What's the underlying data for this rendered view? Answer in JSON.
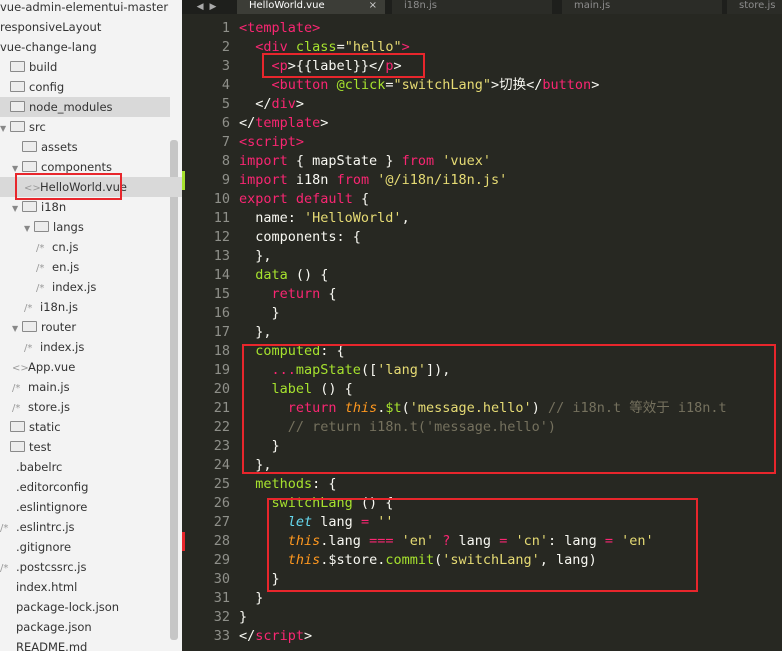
{
  "sidebar": {
    "items": [
      {
        "label": "vue-admin-elementui-master",
        "kind": "text",
        "indent": 0
      },
      {
        "label": "responsiveLayout",
        "kind": "text",
        "indent": 0
      },
      {
        "label": "vue-change-lang",
        "kind": "text",
        "indent": 0
      },
      {
        "label": "build",
        "kind": "folder",
        "indent": 1
      },
      {
        "label": "config",
        "kind": "folder",
        "indent": 1
      },
      {
        "label": "node_modules",
        "kind": "folder",
        "indent": 1,
        "highlight": true
      },
      {
        "label": "src",
        "kind": "open-folder",
        "indent": 1
      },
      {
        "label": "assets",
        "kind": "folder",
        "indent": 2
      },
      {
        "label": "components",
        "kind": "open-folder",
        "indent": 2
      },
      {
        "label": "HelloWorld.vue",
        "kind": "vue",
        "indent": 3,
        "highlight": true
      },
      {
        "label": "i18n",
        "kind": "open-folder",
        "indent": 2
      },
      {
        "label": "langs",
        "kind": "open-folder",
        "indent": 3
      },
      {
        "label": "cn.js",
        "kind": "js",
        "indent": 4
      },
      {
        "label": "en.js",
        "kind": "js",
        "indent": 4
      },
      {
        "label": "index.js",
        "kind": "js",
        "indent": 4
      },
      {
        "label": "i18n.js",
        "kind": "js",
        "indent": 3
      },
      {
        "label": "router",
        "kind": "open-folder",
        "indent": 2
      },
      {
        "label": "index.js",
        "kind": "js",
        "indent": 3
      },
      {
        "label": "App.vue",
        "kind": "vue",
        "indent": 2
      },
      {
        "label": "main.js",
        "kind": "js",
        "indent": 2
      },
      {
        "label": "store.js",
        "kind": "js",
        "indent": 2
      },
      {
        "label": "static",
        "kind": "folder",
        "indent": 1
      },
      {
        "label": "test",
        "kind": "folder",
        "indent": 1
      },
      {
        "label": ".babelrc",
        "kind": "file",
        "indent": 1
      },
      {
        "label": ".editorconfig",
        "kind": "file",
        "indent": 1
      },
      {
        "label": ".eslintignore",
        "kind": "file",
        "indent": 1
      },
      {
        "label": ".eslintrc.js",
        "kind": "js",
        "indent": 1
      },
      {
        "label": ".gitignore",
        "kind": "file",
        "indent": 1
      },
      {
        "label": ".postcssrc.js",
        "kind": "js",
        "indent": 1
      },
      {
        "label": "index.html",
        "kind": "file",
        "indent": 1
      },
      {
        "label": "package-lock.json",
        "kind": "file",
        "indent": 1
      },
      {
        "label": "package.json",
        "kind": "file",
        "indent": 1
      },
      {
        "label": "README.md",
        "kind": "file",
        "indent": 1
      }
    ]
  },
  "tabs": [
    {
      "label": "HelloWorld.vue",
      "active": true,
      "close": "×"
    },
    {
      "label": "i18n.js",
      "active": false
    },
    {
      "label": "main.js",
      "active": false
    },
    {
      "label": "store.js",
      "active": false
    }
  ],
  "tab_nav": "◀▶",
  "colors": {
    "editor_bg": "#272822",
    "tag": "#f92672",
    "attr": "#a6e22e",
    "string": "#e6db74",
    "comment": "#75715e",
    "this": "#fd971f",
    "highlight_box": "#e8262c"
  },
  "code": [
    {
      "n": "1",
      "t": [
        [
          "tag",
          "<template>"
        ]
      ]
    },
    {
      "n": "2",
      "t": [
        [
          "pl",
          "  "
        ],
        [
          "tag",
          "<div"
        ],
        [
          "pl",
          " "
        ],
        [
          "attr",
          "class"
        ],
        [
          "pl",
          "="
        ],
        [
          "str",
          "\"hello\""
        ],
        [
          "tag",
          ">"
        ]
      ]
    },
    {
      "n": "3",
      "t": [
        [
          "pl",
          "    "
        ],
        [
          "tag",
          "<p"
        ],
        [
          "pl",
          ">{{label}}</"
        ],
        [
          "tag",
          "p"
        ],
        [
          "pl",
          ">"
        ]
      ]
    },
    {
      "n": "4",
      "t": [
        [
          "pl",
          "    "
        ],
        [
          "tag",
          "<button"
        ],
        [
          "pl",
          " "
        ],
        [
          "attr",
          "@click"
        ],
        [
          "pl",
          "="
        ],
        [
          "str",
          "\"switchLang\""
        ],
        [
          "pl",
          ">切换</"
        ],
        [
          "tag",
          "button"
        ],
        [
          "pl",
          ">"
        ]
      ]
    },
    {
      "n": "5",
      "t": [
        [
          "pl",
          "  </"
        ],
        [
          "tag",
          "div"
        ],
        [
          "pl",
          ">"
        ]
      ]
    },
    {
      "n": "6",
      "t": [
        [
          "pl",
          "</"
        ],
        [
          "tag",
          "template"
        ],
        [
          "pl",
          ">"
        ]
      ]
    },
    {
      "n": "7",
      "t": [
        [
          "tag",
          "<script>"
        ]
      ]
    },
    {
      "n": "8",
      "t": [
        [
          "kw",
          "import"
        ],
        [
          "pl",
          " { mapState } "
        ],
        [
          "kw",
          "from"
        ],
        [
          "pl",
          " "
        ],
        [
          "str",
          "'vuex'"
        ]
      ]
    },
    {
      "n": "9",
      "t": [
        [
          "kw",
          "import"
        ],
        [
          "pl",
          " i18n "
        ],
        [
          "kw",
          "from"
        ],
        [
          "pl",
          " "
        ],
        [
          "str",
          "'@/i18n/i18n.js'"
        ]
      ]
    },
    {
      "n": "10",
      "t": [
        [
          "kw",
          "export"
        ],
        [
          "pl",
          " "
        ],
        [
          "kw",
          "default"
        ],
        [
          "pl",
          " {"
        ]
      ]
    },
    {
      "n": "11",
      "t": [
        [
          "pl",
          "  name: "
        ],
        [
          "str",
          "'HelloWorld'"
        ],
        [
          "pl",
          ","
        ]
      ]
    },
    {
      "n": "12",
      "t": [
        [
          "pl",
          "  components: {"
        ]
      ]
    },
    {
      "n": "13",
      "t": [
        [
          "pl",
          "  },"
        ]
      ]
    },
    {
      "n": "14",
      "t": [
        [
          "pl",
          "  "
        ],
        [
          "fn",
          "data"
        ],
        [
          "pl",
          " () {"
        ]
      ]
    },
    {
      "n": "15",
      "t": [
        [
          "pl",
          "    "
        ],
        [
          "kw",
          "return"
        ],
        [
          "pl",
          " {"
        ]
      ]
    },
    {
      "n": "16",
      "t": [
        [
          "pl",
          "    }"
        ]
      ]
    },
    {
      "n": "17",
      "t": [
        [
          "pl",
          "  },"
        ]
      ]
    },
    {
      "n": "18",
      "t": [
        [
          "pl",
          "  "
        ],
        [
          "prop",
          "computed"
        ],
        [
          "pl",
          ": {"
        ]
      ]
    },
    {
      "n": "19",
      "t": [
        [
          "pl",
          "    "
        ],
        [
          "kw",
          "..."
        ],
        [
          "fn",
          "mapState"
        ],
        [
          "pl",
          "(["
        ],
        [
          "str",
          "'lang'"
        ],
        [
          "pl",
          "]),"
        ]
      ]
    },
    {
      "n": "20",
      "t": [
        [
          "pl",
          "    "
        ],
        [
          "fn",
          "label"
        ],
        [
          "pl",
          " () {"
        ]
      ]
    },
    {
      "n": "21",
      "t": [
        [
          "pl",
          "      "
        ],
        [
          "kw",
          "return"
        ],
        [
          "pl",
          " "
        ],
        [
          "this",
          "this"
        ],
        [
          "pl",
          "."
        ],
        [
          "fn",
          "$t"
        ],
        [
          "pl",
          "("
        ],
        [
          "str",
          "'message.hello'"
        ],
        [
          "pl",
          ") "
        ],
        [
          "cm",
          "// i18n.t 等效于 i18n.t"
        ]
      ]
    },
    {
      "n": "22",
      "t": [
        [
          "pl",
          "      "
        ],
        [
          "cm",
          "// return i18n.t('message.hello')"
        ]
      ]
    },
    {
      "n": "23",
      "t": [
        [
          "pl",
          "    }"
        ]
      ]
    },
    {
      "n": "24",
      "t": [
        [
          "pl",
          "  },"
        ]
      ]
    },
    {
      "n": "25",
      "t": [
        [
          "pl",
          "  "
        ],
        [
          "prop",
          "methods"
        ],
        [
          "pl",
          ": {"
        ]
      ]
    },
    {
      "n": "26",
      "t": [
        [
          "pl",
          "    "
        ],
        [
          "fn",
          "switchLang"
        ],
        [
          "pl",
          " () {"
        ]
      ]
    },
    {
      "n": "27",
      "t": [
        [
          "pl",
          "      "
        ],
        [
          "let",
          "let"
        ],
        [
          "pl",
          " lang "
        ],
        [
          "kw",
          "="
        ],
        [
          "pl",
          " "
        ],
        [
          "str",
          "''"
        ]
      ]
    },
    {
      "n": "28",
      "t": [
        [
          "pl",
          "      "
        ],
        [
          "this",
          "this"
        ],
        [
          "pl",
          ".lang "
        ],
        [
          "kw",
          "==="
        ],
        [
          "pl",
          " "
        ],
        [
          "str",
          "'en'"
        ],
        [
          "pl",
          " "
        ],
        [
          "kw",
          "?"
        ],
        [
          "pl",
          " lang "
        ],
        [
          "kw",
          "="
        ],
        [
          "pl",
          " "
        ],
        [
          "str",
          "'cn'"
        ],
        [
          "pl",
          ": lang "
        ],
        [
          "kw",
          "="
        ],
        [
          "pl",
          " "
        ],
        [
          "str",
          "'en'"
        ]
      ]
    },
    {
      "n": "29",
      "t": [
        [
          "pl",
          "      "
        ],
        [
          "this",
          "this"
        ],
        [
          "pl",
          ".$store."
        ],
        [
          "fn",
          "commit"
        ],
        [
          "pl",
          "("
        ],
        [
          "str",
          "'switchLang'"
        ],
        [
          "pl",
          ", lang)"
        ]
      ]
    },
    {
      "n": "30",
      "t": [
        [
          "pl",
          "    }"
        ]
      ]
    },
    {
      "n": "31",
      "t": [
        [
          "pl",
          "  }"
        ]
      ]
    },
    {
      "n": "32",
      "t": [
        [
          "pl",
          "}"
        ]
      ]
    },
    {
      "n": "33",
      "t": [
        [
          "pl",
          "</"
        ],
        [
          "tag",
          "script"
        ],
        [
          "pl",
          ">"
        ]
      ]
    }
  ]
}
